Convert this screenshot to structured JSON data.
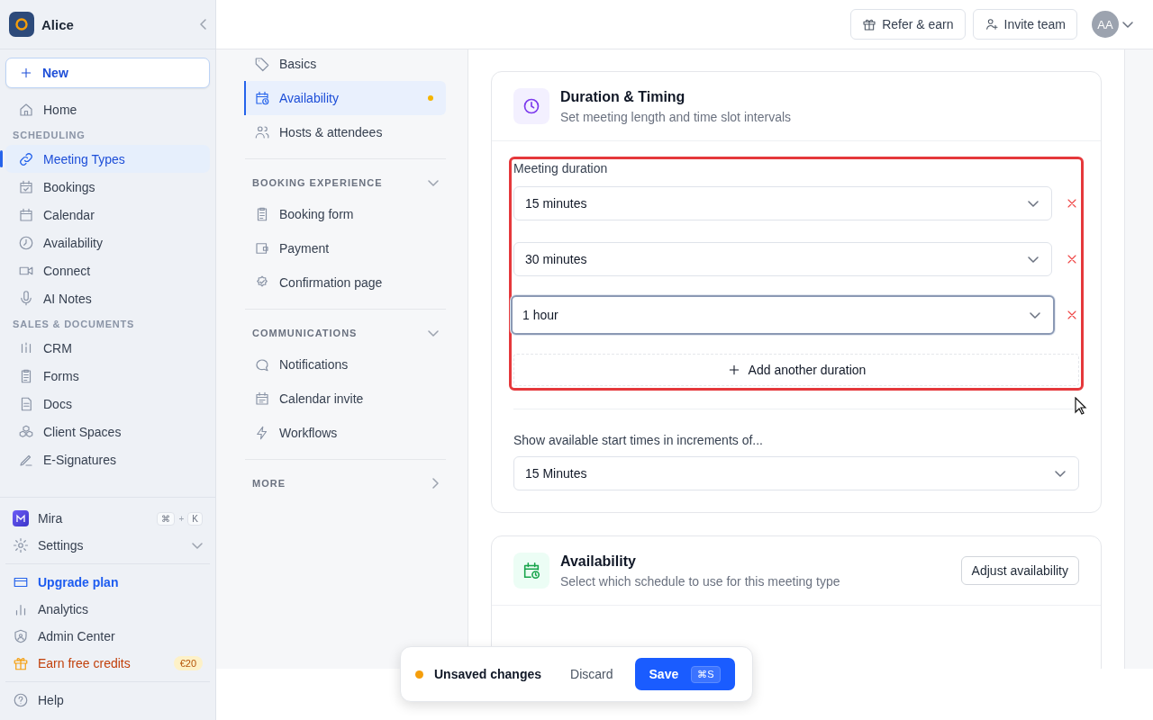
{
  "sidebar": {
    "workspace": "Alice",
    "new_button": "New",
    "nav": [
      {
        "kind": "item",
        "label": "Home",
        "selected": false
      },
      {
        "kind": "heading",
        "label": "SCHEDULING"
      },
      {
        "kind": "item",
        "label": "Meeting Types",
        "selected": true
      },
      {
        "kind": "item",
        "label": "Bookings",
        "selected": false
      },
      {
        "kind": "item",
        "label": "Calendar",
        "selected": false
      },
      {
        "kind": "item",
        "label": "Availability",
        "selected": false
      },
      {
        "kind": "item",
        "label": "Connect",
        "selected": false
      },
      {
        "kind": "item",
        "label": "AI Notes",
        "selected": false
      },
      {
        "kind": "heading",
        "label": "SALES & DOCUMENTS"
      },
      {
        "kind": "item",
        "label": "CRM",
        "selected": false
      },
      {
        "kind": "item",
        "label": "Forms",
        "selected": false
      },
      {
        "kind": "item",
        "label": "Docs",
        "selected": false
      },
      {
        "kind": "item",
        "label": "Client Spaces",
        "selected": false
      },
      {
        "kind": "item",
        "label": "E-Signatures",
        "selected": false
      }
    ],
    "footer": [
      {
        "kind": "assistant",
        "label": "Mira",
        "shortcut": [
          "⌘",
          "+",
          "K"
        ]
      },
      {
        "kind": "expandable",
        "label": "Settings",
        "expanded": false
      },
      {
        "kind": "divider"
      },
      {
        "kind": "accent",
        "label": "Upgrade plan"
      },
      {
        "kind": "plain",
        "label": "Analytics"
      },
      {
        "kind": "plain",
        "label": "Admin Center"
      },
      {
        "kind": "promo",
        "label": "Earn free credits",
        "badge": "€20"
      },
      {
        "kind": "divider"
      },
      {
        "kind": "plain",
        "label": "Help"
      }
    ]
  },
  "topbar": {
    "buttons": [
      "Refer & earn",
      "Invite team"
    ],
    "avatar": "AA"
  },
  "subnav": {
    "items": [
      {
        "label": "Basics",
        "selected": false,
        "unsaved": false
      },
      {
        "label": "Availability",
        "selected": true,
        "unsaved": true
      },
      {
        "label": "Hosts & attendees",
        "selected": false,
        "unsaved": false
      }
    ],
    "groups": [
      {
        "heading": "BOOKING EXPERIENCE",
        "expanded": true,
        "items": [
          {
            "label": "Booking form"
          },
          {
            "label": "Payment"
          },
          {
            "label": "Confirmation page"
          }
        ]
      },
      {
        "heading": "COMMUNICATIONS",
        "expanded": true,
        "items": [
          {
            "label": "Notifications"
          },
          {
            "label": "Calendar invite"
          },
          {
            "label": "Workflows"
          }
        ]
      },
      {
        "heading": "MORE",
        "expanded": false
      }
    ]
  },
  "duration_card": {
    "title": "Duration & Timing",
    "subtitle": "Set meeting length and time slot intervals",
    "duration": {
      "highlighted": true,
      "label": "Meeting duration",
      "options": [
        {
          "value": "15 minutes",
          "focused": false
        },
        {
          "value": "30 minutes",
          "focused": false
        },
        {
          "value": "1 hour",
          "focused": true
        }
      ],
      "add_button": "Add another duration"
    },
    "increment_label": "Show available start times in increments of...",
    "increment_value": "15 Minutes"
  },
  "availability_card": {
    "title": "Availability",
    "subtitle": "Select which schedule to use for this meeting type",
    "button": "Adjust availability"
  },
  "toast": {
    "message": "Unsaved changes",
    "discard": "Discard",
    "save": "Save",
    "shortcut": "⌘S"
  }
}
